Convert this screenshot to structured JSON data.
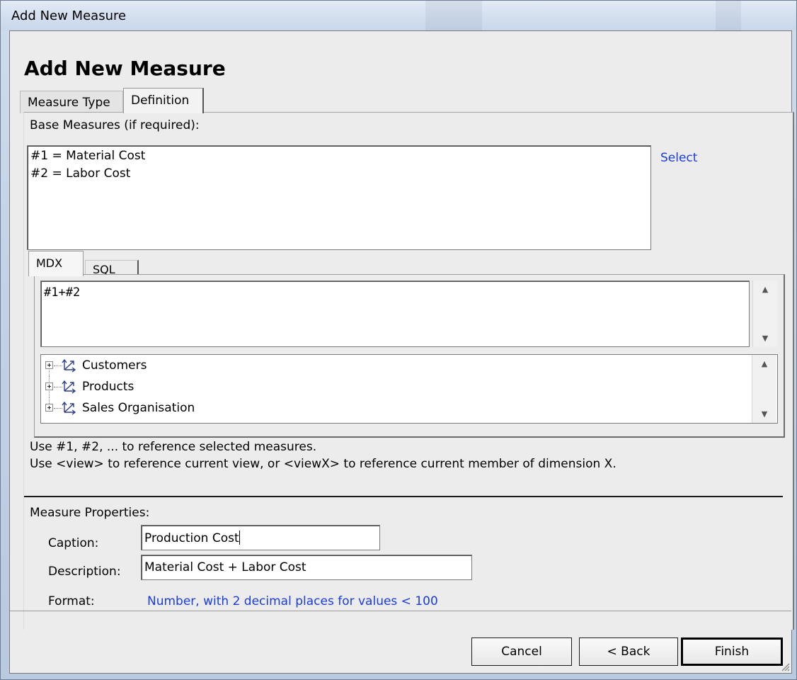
{
  "window": {
    "title": "Add New Measure"
  },
  "dialog": {
    "heading": "Add New Measure"
  },
  "tabs": [
    {
      "label": "Measure Type",
      "active": false
    },
    {
      "label": "Definition",
      "active": true
    }
  ],
  "base_measures": {
    "label": "Base Measures (if required):",
    "items": [
      "#1 = Material Cost",
      "#2 = Labor Cost"
    ],
    "select_link": "Select"
  },
  "query_tabs": [
    {
      "label": "MDX",
      "active": true
    },
    {
      "label": "SQL",
      "active": false
    }
  ],
  "expression": {
    "value": "#1+#2"
  },
  "dimension_tree": {
    "items": [
      {
        "label": "Customers",
        "icon": "dimension-icon"
      },
      {
        "label": "Products",
        "icon": "dimension-icon"
      },
      {
        "label": "Sales Organisation",
        "icon": "dimension-icon"
      }
    ]
  },
  "help": {
    "line1": "Use #1, #2, ... to reference selected measures.",
    "line2": "Use <view> to reference current view, or <viewX> to reference current member of dimension X."
  },
  "properties": {
    "section_label": "Measure Properties:",
    "caption_label": "Caption:",
    "caption_value": "Production Cost",
    "description_label": "Description:",
    "description_value": "Material Cost + Labor Cost",
    "format_label": "Format:",
    "format_value": "Number, with 2 decimal places for values < 100"
  },
  "buttons": {
    "cancel": "Cancel",
    "back": "< Back",
    "finish": "Finish"
  },
  "colors": {
    "link": "#1a3cdc",
    "dialog_bg": "#ececec",
    "frame": "#c3d2e6"
  }
}
